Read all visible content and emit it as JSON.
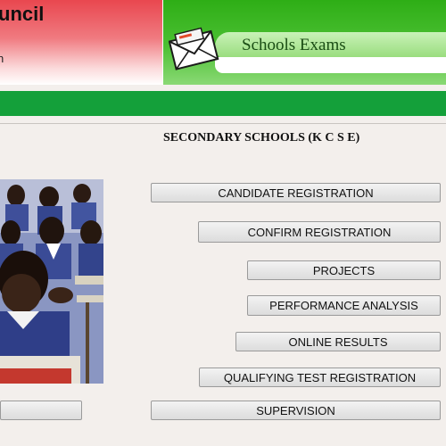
{
  "header": {
    "council_title": "uncil",
    "council_subtitle": "n",
    "banner_title": "Schools Exams"
  },
  "section": {
    "title": "SECONDARY SCHOOLS (K C S E)"
  },
  "buttons": [
    {
      "label": "CANDIDATE REGISTRATION"
    },
    {
      "label": "CONFIRM REGISTRATION"
    },
    {
      "label": "PROJECTS"
    },
    {
      "label": "PERFORMANCE ANALYSIS"
    },
    {
      "label": "ONLINE RESULTS"
    },
    {
      "label": "QUALIFYING TEST REGISTRATION"
    },
    {
      "label": "SUPERVISION"
    },
    {
      "label": ""
    }
  ],
  "icons": {
    "envelope": "envelope-icon"
  },
  "colors": {
    "header_red": "#e9474f",
    "header_green": "#2eae16",
    "strip_green": "#14a03a",
    "background": "#f3efec"
  }
}
